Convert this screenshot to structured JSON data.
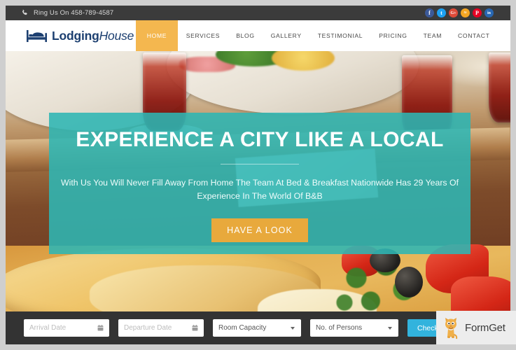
{
  "topbar": {
    "phone_icon": "phone-icon",
    "phone_text": "Ring Us On 458-789-4587",
    "socials": [
      {
        "name": "facebook",
        "glyph": "f",
        "color": "#3b5998"
      },
      {
        "name": "twitter",
        "glyph": "t",
        "color": "#1da1f2"
      },
      {
        "name": "google-plus",
        "glyph": "G+",
        "color": "#dd4b39"
      },
      {
        "name": "rss",
        "glyph": "≈",
        "color": "#f5a623"
      },
      {
        "name": "pinterest",
        "glyph": "P",
        "color": "#e60023"
      },
      {
        "name": "linkedin",
        "glyph": "in",
        "color": "#2867b2"
      }
    ],
    "background": "#3b3b3b"
  },
  "header": {
    "logo": {
      "icon": "bed-icon",
      "bold_part": "Lodging",
      "italic_part": "House",
      "color": "#1c3f70"
    },
    "nav": [
      {
        "label": "HOME",
        "active": true
      },
      {
        "label": "SERVICES",
        "active": false
      },
      {
        "label": "BLOG",
        "active": false
      },
      {
        "label": "GALLERY",
        "active": false
      },
      {
        "label": "TESTIMONIAL",
        "active": false
      },
      {
        "label": "PRICING",
        "active": false
      },
      {
        "label": "TEAM",
        "active": false
      },
      {
        "label": "CONTACT",
        "active": false
      }
    ],
    "active_color": "#f4b74f"
  },
  "hero": {
    "title": "EXPERIENCE A CITY LIKE A LOCAL",
    "subtitle_line1": "With Us You Will Never Fill Away From Home The Team At Bed & Breakfast Nationwide Has 29 Years",
    "subtitle_line2": "Of Experience In The World Of B&B",
    "cta_label": "HAVE A LOOK",
    "panel_color": "#2eb6b4",
    "cta_color": "#e8a93c"
  },
  "booking": {
    "arrival_placeholder": "Arrival Date",
    "departure_placeholder": "Departure Date",
    "room_capacity_value": "Room Capacity",
    "persons_value": "No. of Persons",
    "check_button_label": "Check Availability",
    "button_color": "#32b3dd",
    "background": "#333333"
  },
  "watermark": {
    "label": "FormGet",
    "icon": "cat-mascot-icon"
  }
}
